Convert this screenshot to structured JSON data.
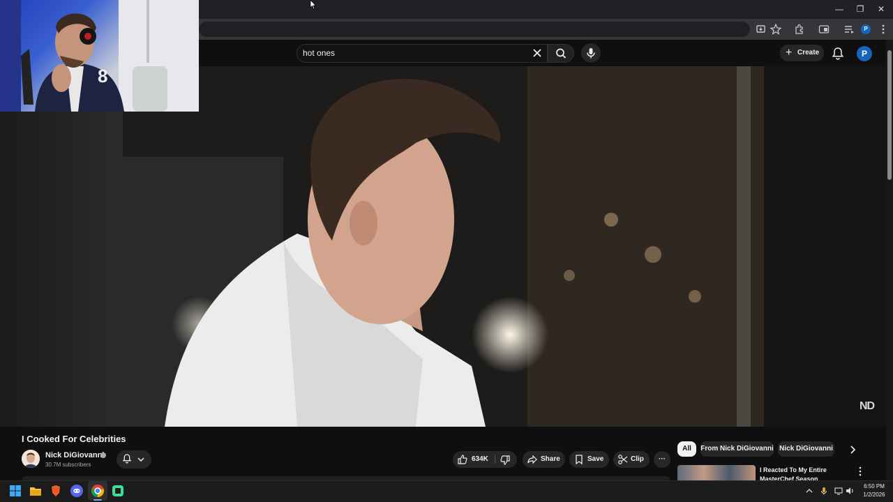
{
  "browser": {
    "window_controls": {
      "minimize": "—",
      "restore": "❐",
      "close": "✕"
    },
    "toolbar_icons": [
      "install-app-icon",
      "bookmark-star-icon",
      "extensions-icon",
      "split-view-icon",
      "media-queue-icon",
      "profile-icon",
      "menu-icon"
    ],
    "profile_initial": "P"
  },
  "header": {
    "search": {
      "value": "hot ones",
      "placeholder": "Search"
    },
    "create_label": "Create",
    "avatar_initial": "P"
  },
  "video": {
    "title": "I Cooked For Celebrities",
    "watermark": "ND",
    "channel": {
      "name": "Nick DiGiovanni",
      "subscribers": "30.7M subscribers"
    },
    "actions": {
      "likes": "634K",
      "share": "Share",
      "save": "Save",
      "clip": "Clip",
      "more": "···"
    }
  },
  "sidebar": {
    "chips": [
      "All",
      "From Nick DiGiovanni",
      "Nick DiGiovanni"
    ],
    "recommendation": {
      "title": "I Reacted To My Entire MasterChef Season"
    }
  },
  "taskbar": {
    "apps": [
      "windows-start-icon",
      "file-explorer-icon",
      "brave-browser-icon",
      "discord-icon",
      "chrome-icon",
      "terminal-app-icon"
    ],
    "time": "6:50 PM",
    "date": "1/2/2026"
  },
  "colors": {
    "accent_blue": "#1565c0",
    "background": "#0f0f0f",
    "chip_active": "#f1f1f1",
    "pill": "#272727"
  }
}
